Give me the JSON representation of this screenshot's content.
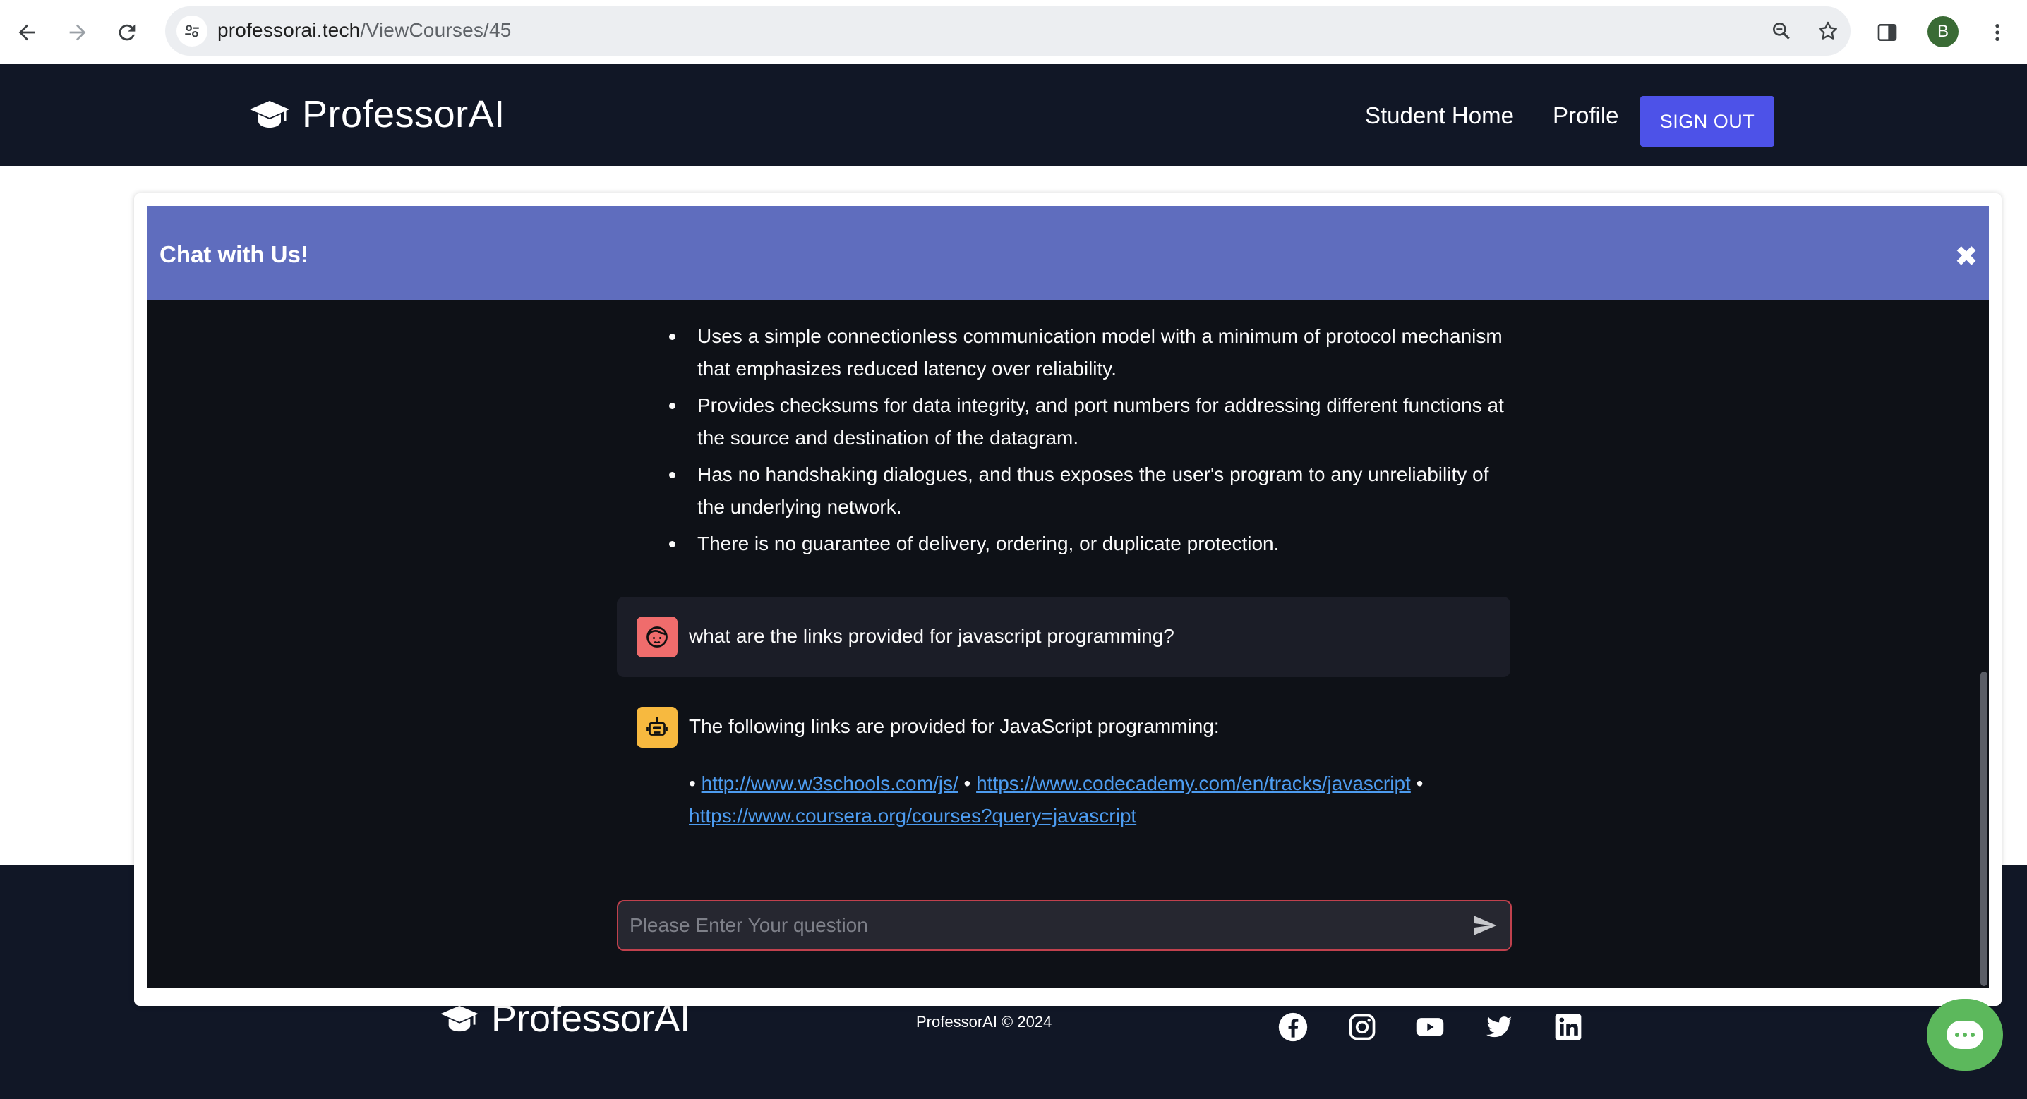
{
  "browser": {
    "url_domain": "professorai.tech",
    "url_path": "/ViewCourses/45",
    "profile_initial": "B"
  },
  "header": {
    "brand": "ProfessorAI",
    "nav": [
      "Student Home",
      "Profile"
    ],
    "signout": "SIGN OUT"
  },
  "chat": {
    "title": "Chat with Us!",
    "close_glyph": "✖",
    "bullets": [
      "Uses a simple connectionless communication model with a minimum of protocol mechanism that emphasizes reduced latency over reliability.",
      "Provides checksums for data integrity, and port numbers for addressing different functions at the source and destination of the datagram.",
      "Has no handshaking dialogues, and thus exposes the user's program to any unreliability of the underlying network.",
      "There is no guarantee of delivery, ordering, or duplicate protection."
    ],
    "user_message": "what are the links provided for javascript programming?",
    "bot_message": "The following links are provided for JavaScript programming:",
    "bot_links": [
      "http://www.w3schools.com/js/",
      "https://www.codecademy.com/en/tracks/javascript",
      "https://www.coursera.org/courses?query=javascript"
    ],
    "bullet_separator": "•",
    "input_placeholder": "Please Enter Your question"
  },
  "footer": {
    "brand": "ProfessorAI",
    "copyright": "ProfessorAI © 2024",
    "social_icons": [
      "facebook-icon",
      "instagram-icon",
      "youtube-icon",
      "twitter-icon",
      "linkedin-icon"
    ]
  },
  "colors": {
    "header_bg": "#111726",
    "signout_bg": "#4d52e8",
    "chat_header_bg": "#5f6dbe",
    "chat_body_bg": "#0e1117",
    "link": "#4d9cf0",
    "user_avatar": "#f06c6c",
    "bot_avatar": "#f7b93f",
    "chat_fab": "#5cb85c"
  }
}
